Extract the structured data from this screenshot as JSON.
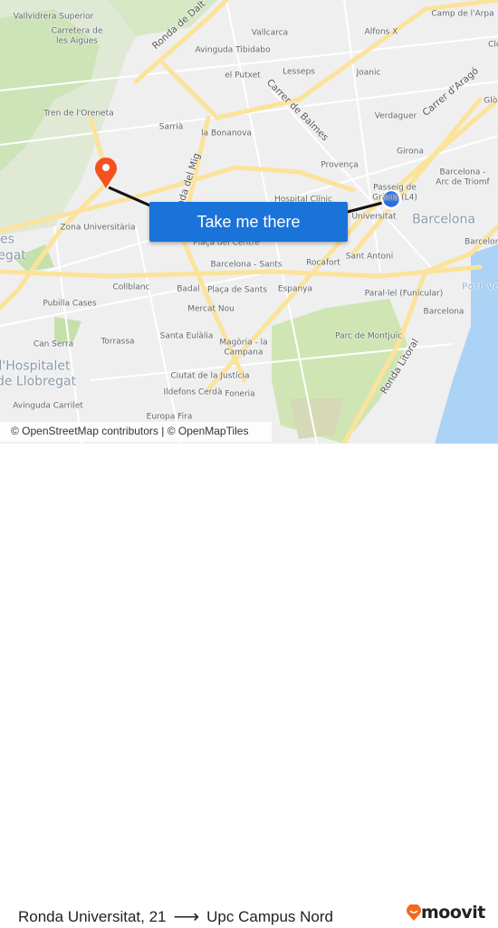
{
  "map": {
    "labels": {
      "vallvidrera": "Vallvidrera Superior",
      "carretera1": "Carretera de",
      "carretera2": "les Aigues",
      "ronda_dalt": "Ronda de Dalt",
      "tibidabo": "Avinguda Tibidabo",
      "vallcarca": "Vallcarca",
      "alfons": "Alfons X",
      "camp_arpa": "Camp de l'Arpa",
      "clot": "Clot",
      "putxet": "el Putxet",
      "lesseps": "Lesseps",
      "joanic": "Joanic",
      "balmes": "Carrer de Balmes",
      "arago": "Carrer d'Aragó",
      "glories": "Glòries",
      "oreneta": "Tren de l'Oreneta",
      "sarria": "Sarrià",
      "bonanova": "la Bonanova",
      "verdaguer": "Verdaguer",
      "ronda_mig": "Ronda del Mig",
      "girona": "Girona",
      "provenca": "Provença",
      "arc1": "Barcelona -",
      "arc2": "Arc de Triomf",
      "pg1": "Passeig de",
      "pg2": "Gràcia (L4)",
      "clinic": "Hospital Clínic",
      "universitat": "Universitat",
      "barcelona_city": "Barcelona",
      "zona_univ": "Zona Universitària",
      "placa_centre": "Plaça del Centre",
      "sants": "Barcelona - Sants",
      "rocafort": "Rocafort",
      "sant_antoni": "Sant Antoni",
      "barceloneta": "Barceloneta",
      "port_vell": "Port Vell",
      "collblanc": "Collblanc",
      "badal": "Badal",
      "placa_sants": "Plaça de Sants",
      "espanya": "Espanya",
      "parallel": "Paral·lel (Funicular)",
      "pubilla": "Pubilla Cases",
      "mercat_nou": "Mercat Nou",
      "barcelona_stn": "Barcelona",
      "santa_eulalia": "Santa Eulàlia",
      "montjuic": "Parc de Montjuïc",
      "can_serra": "Can Serra",
      "torrassa": "Torrassa",
      "magoria1": "Magòria - la",
      "magoria2": "Campana",
      "hospitalet1": "l'Hospitalet",
      "hospitalet2": "de Llobregat",
      "esplugues1": "es",
      "esplugues2": "egat",
      "justicia": "Ciutat de la Justícia",
      "litoral": "Ronda Litoral",
      "cerda": "Ildefons Cerdà",
      "foneria": "Foneria",
      "carrilet": "Avinguda Carrilet",
      "europa": "Europa Fira"
    },
    "attribution": "© OpenStreetMap contributors | © OpenMapTiles",
    "cta_label": "Take me there",
    "origin_marker_color": "#1a73e8",
    "destination_marker_color": "#f4511e"
  },
  "footer": {
    "from": "Ronda Universitat, 21",
    "arrow": "⟶",
    "to": "Upc Campus Nord",
    "brand": "moovit",
    "brand_color": "#f26a21"
  }
}
